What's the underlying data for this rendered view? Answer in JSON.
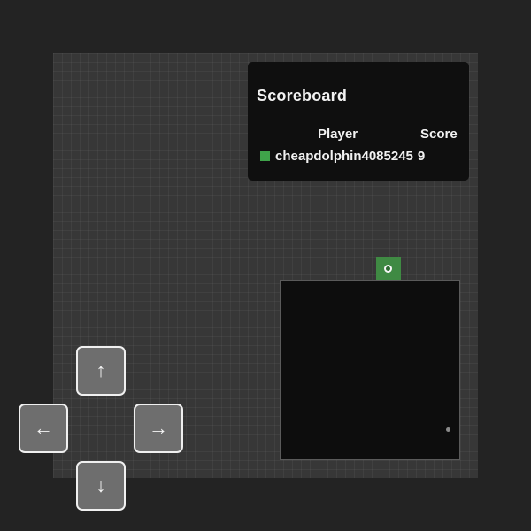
{
  "scoreboard": {
    "title": "Scoreboard",
    "columns": {
      "player": "Player",
      "score": "Score"
    },
    "rows": [
      {
        "player": "cheapdolphin4085245",
        "score": "9",
        "color": "#3fa34a"
      }
    ]
  },
  "controls": {
    "up": "↑",
    "left": "←",
    "right": "→",
    "down": "↓"
  },
  "colors": {
    "background": "#232323",
    "board": "#373737",
    "panel": "#0f0f0f",
    "snake": "#3f8a43",
    "minimap": "#0d0d0d"
  },
  "icons": {
    "up": "arrow-up-icon",
    "left": "arrow-left-icon",
    "right": "arrow-right-icon",
    "down": "arrow-down-icon",
    "snake_eye": "snake-eye-icon"
  }
}
